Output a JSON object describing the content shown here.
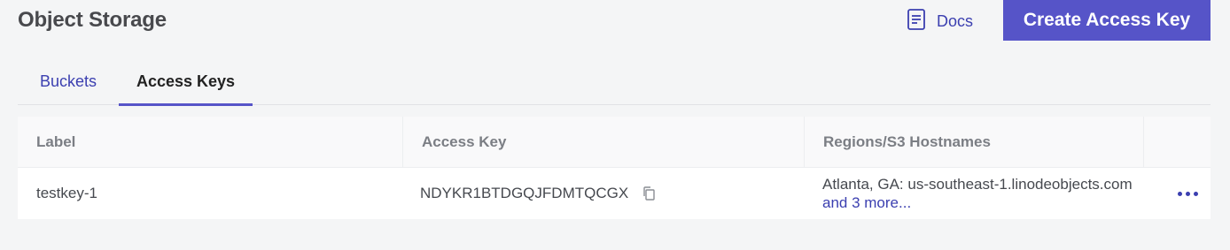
{
  "header": {
    "title": "Object Storage",
    "docs_label": "Docs",
    "create_button_label": "Create Access Key"
  },
  "tabs": [
    {
      "label": "Buckets",
      "active": false
    },
    {
      "label": "Access Keys",
      "active": true
    }
  ],
  "table": {
    "columns": [
      "Label",
      "Access Key",
      "Regions/S3 Hostnames",
      ""
    ],
    "rows": [
      {
        "label": "testkey-1",
        "access_key": "NDYKR1BTDGQJFDMTQCGX",
        "regions": "Atlanta, GA: us-southeast-1.linodeobjects.com",
        "more_link": "and 3 more..."
      }
    ]
  },
  "colors": {
    "accent": "#5654c8",
    "link": "#3b3fb0",
    "background": "#f4f5f6"
  },
  "icons": {
    "docs": "document-icon",
    "copy": "copy-icon",
    "actions": "ellipsis-icon"
  }
}
